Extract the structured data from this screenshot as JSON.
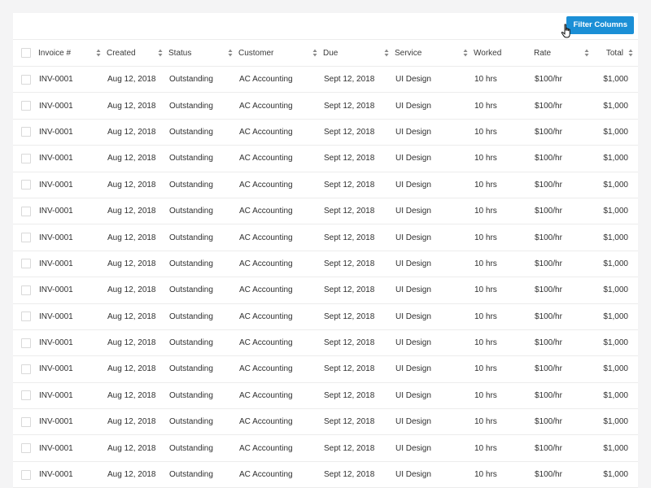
{
  "toolbar": {
    "filter_button_label": "Filter Columns"
  },
  "table": {
    "columns": [
      {
        "label": "Invoice #",
        "sortable": true
      },
      {
        "label": "Created",
        "sortable": true
      },
      {
        "label": "Status",
        "sortable": true
      },
      {
        "label": "Customer",
        "sortable": true
      },
      {
        "label": "Due",
        "sortable": true
      },
      {
        "label": "Service",
        "sortable": true
      },
      {
        "label": "Worked",
        "sortable": false
      },
      {
        "label": "Rate",
        "sortable": true
      },
      {
        "label": "Total",
        "sortable": true
      }
    ],
    "rows": [
      {
        "invoice": "INV-0001",
        "created": "Aug 12, 2018",
        "status": "Outstanding",
        "customer": "AC Accounting",
        "due": "Sept 12, 2018",
        "service": "UI Design",
        "worked": "10 hrs",
        "rate": "$100/hr",
        "total": "$1,000"
      },
      {
        "invoice": "INV-0001",
        "created": "Aug 12, 2018",
        "status": "Outstanding",
        "customer": "AC Accounting",
        "due": "Sept 12, 2018",
        "service": "UI Design",
        "worked": "10 hrs",
        "rate": "$100/hr",
        "total": "$1,000"
      },
      {
        "invoice": "INV-0001",
        "created": "Aug 12, 2018",
        "status": "Outstanding",
        "customer": "AC Accounting",
        "due": "Sept 12, 2018",
        "service": "UI Design",
        "worked": "10 hrs",
        "rate": "$100/hr",
        "total": "$1,000"
      },
      {
        "invoice": "INV-0001",
        "created": "Aug 12, 2018",
        "status": "Outstanding",
        "customer": "AC Accounting",
        "due": "Sept 12, 2018",
        "service": "UI Design",
        "worked": "10 hrs",
        "rate": "$100/hr",
        "total": "$1,000"
      },
      {
        "invoice": "INV-0001",
        "created": "Aug 12, 2018",
        "status": "Outstanding",
        "customer": "AC Accounting",
        "due": "Sept 12, 2018",
        "service": "UI Design",
        "worked": "10 hrs",
        "rate": "$100/hr",
        "total": "$1,000"
      },
      {
        "invoice": "INV-0001",
        "created": "Aug 12, 2018",
        "status": "Outstanding",
        "customer": "AC Accounting",
        "due": "Sept 12, 2018",
        "service": "UI Design",
        "worked": "10 hrs",
        "rate": "$100/hr",
        "total": "$1,000"
      },
      {
        "invoice": "INV-0001",
        "created": "Aug 12, 2018",
        "status": "Outstanding",
        "customer": "AC Accounting",
        "due": "Sept 12, 2018",
        "service": "UI Design",
        "worked": "10 hrs",
        "rate": "$100/hr",
        "total": "$1,000"
      },
      {
        "invoice": "INV-0001",
        "created": "Aug 12, 2018",
        "status": "Outstanding",
        "customer": "AC Accounting",
        "due": "Sept 12, 2018",
        "service": "UI Design",
        "worked": "10 hrs",
        "rate": "$100/hr",
        "total": "$1,000"
      },
      {
        "invoice": "INV-0001",
        "created": "Aug 12, 2018",
        "status": "Outstanding",
        "customer": "AC Accounting",
        "due": "Sept 12, 2018",
        "service": "UI Design",
        "worked": "10 hrs",
        "rate": "$100/hr",
        "total": "$1,000"
      },
      {
        "invoice": "INV-0001",
        "created": "Aug 12, 2018",
        "status": "Outstanding",
        "customer": "AC Accounting",
        "due": "Sept 12, 2018",
        "service": "UI Design",
        "worked": "10 hrs",
        "rate": "$100/hr",
        "total": "$1,000"
      },
      {
        "invoice": "INV-0001",
        "created": "Aug 12, 2018",
        "status": "Outstanding",
        "customer": "AC Accounting",
        "due": "Sept 12, 2018",
        "service": "UI Design",
        "worked": "10 hrs",
        "rate": "$100/hr",
        "total": "$1,000"
      },
      {
        "invoice": "INV-0001",
        "created": "Aug 12, 2018",
        "status": "Outstanding",
        "customer": "AC Accounting",
        "due": "Sept 12, 2018",
        "service": "UI Design",
        "worked": "10 hrs",
        "rate": "$100/hr",
        "total": "$1,000"
      },
      {
        "invoice": "INV-0001",
        "created": "Aug 12, 2018",
        "status": "Outstanding",
        "customer": "AC Accounting",
        "due": "Sept 12, 2018",
        "service": "UI Design",
        "worked": "10 hrs",
        "rate": "$100/hr",
        "total": "$1,000"
      },
      {
        "invoice": "INV-0001",
        "created": "Aug 12, 2018",
        "status": "Outstanding",
        "customer": "AC Accounting",
        "due": "Sept 12, 2018",
        "service": "UI Design",
        "worked": "10 hrs",
        "rate": "$100/hr",
        "total": "$1,000"
      },
      {
        "invoice": "INV-0001",
        "created": "Aug 12, 2018",
        "status": "Outstanding",
        "customer": "AC Accounting",
        "due": "Sept 12, 2018",
        "service": "UI Design",
        "worked": "10 hrs",
        "rate": "$100/hr",
        "total": "$1,000"
      },
      {
        "invoice": "INV-0001",
        "created": "Aug 12, 2018",
        "status": "Outstanding",
        "customer": "AC Accounting",
        "due": "Sept 12, 2018",
        "service": "UI Design",
        "worked": "10 hrs",
        "rate": "$100/hr",
        "total": "$1,000"
      }
    ]
  },
  "colors": {
    "accent": "#1b8fd6",
    "page_background": "#f4f4f5",
    "card_background": "#ffffff",
    "divider": "#ececec"
  },
  "icons": {
    "sort": "sort-icon",
    "cursor": "hand-cursor-icon",
    "checkbox": "checkbox"
  }
}
